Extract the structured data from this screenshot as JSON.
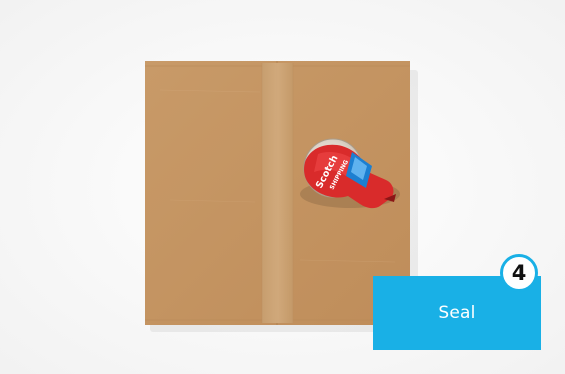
{
  "step": {
    "number": "4",
    "label": "Seal"
  },
  "tape_dispenser": {
    "brand": "Scotch",
    "product": "SHIPPING"
  },
  "colors": {
    "background": "#ffffff",
    "accent": "#19b0e6",
    "box": "#c89866",
    "tape_dispenser": "#d92b2b"
  }
}
